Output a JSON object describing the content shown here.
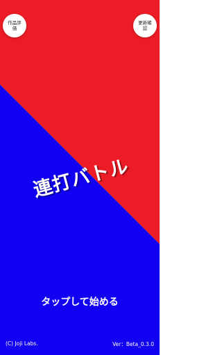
{
  "colors": {
    "top_background": "#ec1c26",
    "bottom_background": "#1100f2",
    "text": "#ffffff"
  },
  "buttons": {
    "rate_label": "作品評価",
    "update_label": "更新確認"
  },
  "title": "連打バトル",
  "start_prompt": "タップして始める",
  "footer": {
    "copyright": "(C) Joji Labs.",
    "version": "Ver：Beta_0.3.0"
  }
}
